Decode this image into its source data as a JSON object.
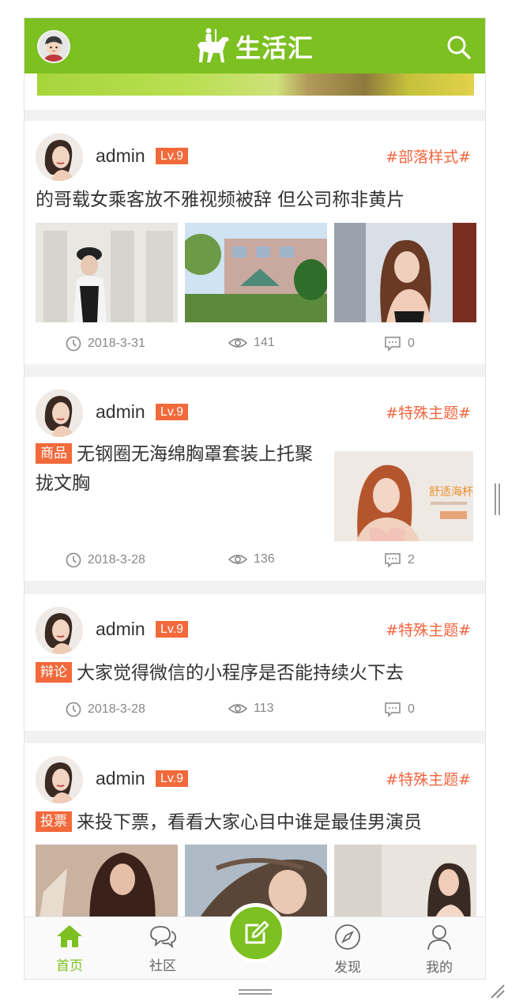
{
  "app": {
    "title": "生活汇"
  },
  "posts": [
    {
      "user": "admin",
      "level": "Lv.9",
      "topic": "#部落样式#",
      "tag": "",
      "title": "的哥载女乘客放不雅视频被辞 但公司称非黄片",
      "date": "2018-3-31",
      "views": "141",
      "comments": "0"
    },
    {
      "user": "admin",
      "level": "Lv.9",
      "topic": "#特殊主题#",
      "tag": "商品",
      "title": "无钢圈无海绵胸罩套装上托聚拢文胸",
      "thumb_text": "舒适海杯",
      "date": "2018-3-28",
      "views": "136",
      "comments": "2"
    },
    {
      "user": "admin",
      "level": "Lv.9",
      "topic": "#特殊主题#",
      "tag": "辩论",
      "title": "大家觉得微信的小程序是否能持续火下去",
      "date": "2018-3-28",
      "views": "113",
      "comments": "0"
    },
    {
      "user": "admin",
      "level": "Lv.9",
      "topic": "#特殊主题#",
      "tag": "投票",
      "title": "来投下票，看看大家心目中谁是最佳男演员"
    }
  ],
  "tabbar": {
    "home": "首页",
    "community": "社区",
    "discover": "发现",
    "mine": "我的"
  },
  "colors": {
    "brand": "#7cc021",
    "accent": "#f2693b"
  }
}
